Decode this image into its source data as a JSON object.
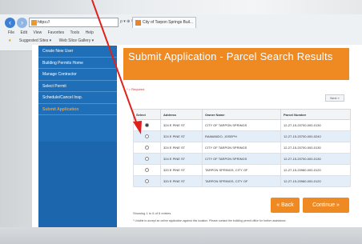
{
  "browser": {
    "url": "https://",
    "tab_title": "City of Tarpon Springs Buil...",
    "menu": [
      "File",
      "Edit",
      "View",
      "Favorites",
      "Tools",
      "Help"
    ],
    "favorites": [
      "Suggested Sites ▾",
      "Web Slice Gallery ▾"
    ]
  },
  "sidebar": {
    "items": [
      {
        "label": "Create New User"
      },
      {
        "label": "Building Permits Home"
      },
      {
        "label": "Manage Contractor"
      },
      {
        "label": "Select Permit"
      },
      {
        "label": "Schedule/Cancel Insp."
      },
      {
        "label": "Submit Application"
      }
    ]
  },
  "main": {
    "title": "Submit Application - Parcel Search Results",
    "required_note": "* = Required",
    "next_label": "Next »",
    "table": {
      "headers": [
        "Select",
        "Address",
        "Owner Name",
        "Parcel Number"
      ],
      "rows": [
        {
          "selected": true,
          "address": "324 E PINE ST",
          "owner": "CITY OF TARPON SPRINGS",
          "parcel": "12-27-15-20700-000-0130"
        },
        {
          "selected": false,
          "address": "324 E PINE ST",
          "owner": "RAIMANDO, JOSEPH",
          "parcel": "12-27-15-20700-000-0240"
        },
        {
          "selected": false,
          "address": "324 E PINE ST",
          "owner": "CITY OF TARPON SPRINGS",
          "parcel": "12-27-15-20700-000-0130"
        },
        {
          "selected": false,
          "address": "324 E PINE ST",
          "owner": "CITY OF TARPON SPRINGS",
          "parcel": "12-27-15-20700-000-0130"
        },
        {
          "selected": false,
          "address": "320 E PINE ST",
          "owner": "TARPON SPRINGS, CITY OF",
          "parcel": "12-27-15-20980-000-0120"
        },
        {
          "selected": false,
          "address": "320 E PINE ST",
          "owner": "TARPON SPRINGS, CITY OF",
          "parcel": "12-27-15-20980-000-0120"
        }
      ]
    },
    "showing": "Showing 1 to 6 of 6 entries",
    "note": "* Unable to accept an online application against this location. Please contact the building permit office for further assistance.",
    "back_label": "« Back",
    "continue_label": "Continue »"
  },
  "colors": {
    "accent": "#ef8a22",
    "sidebar": "#1f6fb8",
    "arrow": "#e0201b"
  }
}
